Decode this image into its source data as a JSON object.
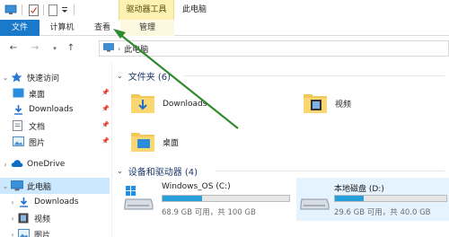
{
  "titlebar": {
    "context_group": "驱动器工具",
    "window_title": "此电脑",
    "quick_access_toolbar": [
      "computer-icon",
      "properties-icon",
      "new-folder-icon",
      "customize-chevron-icon"
    ]
  },
  "ribbon": {
    "tabs": [
      {
        "label": "文件"
      },
      {
        "label": "计算机"
      },
      {
        "label": "查看"
      },
      {
        "label": "管理"
      }
    ]
  },
  "address": {
    "path": "此电脑",
    "back_icon": "back-arrow-icon",
    "forward_icon": "forward-arrow-icon",
    "recent_icon": "recent-chevron-icon",
    "up_icon": "up-arrow-icon"
  },
  "nav": {
    "quick_access": "快速访问",
    "desktop": "桌面",
    "downloads": "Downloads",
    "documents": "文档",
    "pictures": "图片",
    "onedrive": "OneDrive",
    "this_pc": "此电脑",
    "pc_downloads": "Downloads",
    "videos": "视频",
    "pc_pictures": "图片"
  },
  "content": {
    "folders_header": "文件夹 (6)",
    "folders": [
      {
        "name": "Downloads"
      },
      {
        "name": "视频"
      },
      {
        "name": "桌面"
      }
    ],
    "drives_header": "设备和驱动器 (4)",
    "drives": [
      {
        "name": "Windows_OS (C:)",
        "size_text": "68.9 GB 可用，共 100 GB",
        "used_fraction": 0.31
      },
      {
        "name": "本地磁盘 (D:)",
        "size_text": "29.6 GB 可用，共 40.0 GB",
        "used_fraction": 0.26
      }
    ]
  },
  "colors": {
    "accent_blue": "#1979ca",
    "context_yellow": "#fdf1b4",
    "annotation_green": "#2e8b2e",
    "selection": "#cce8ff",
    "drive_fill": "#26a0da"
  }
}
